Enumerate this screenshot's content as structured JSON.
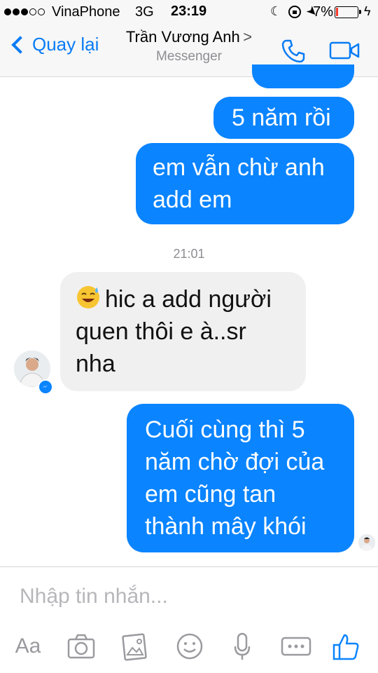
{
  "status_bar": {
    "carrier": "VinaPhone",
    "network": "3G",
    "time": "23:19",
    "battery_percent": "7%"
  },
  "header": {
    "back_label": "Quay lại",
    "contact_name": "Trần Vương Anh",
    "contact_subtitle": "Messenger",
    "accent_color": "#0a7cf5"
  },
  "messages": [
    {
      "side": "out",
      "text": "5 năm rồi"
    },
    {
      "side": "out",
      "lines": [
        "em vẫn chừ anh",
        "add em"
      ]
    },
    {
      "type": "timestamp",
      "text": "21:01"
    },
    {
      "side": "in",
      "emoji": "sweat-smile-emoji",
      "lines": [
        "hic a add người",
        "quen thôi e à..sr",
        "nha"
      ]
    },
    {
      "side": "out",
      "lines": [
        "Cuối cùng thì 5",
        "năm chờ đợi của",
        "em cũng tan",
        "thành mây khói"
      ]
    }
  ],
  "composer": {
    "placeholder": "Nhập tin nhắn...",
    "aa_label": "Aa",
    "tools": [
      "camera-icon",
      "gallery-icon",
      "emoji-icon",
      "microphone-icon",
      "more-icon",
      "like-icon"
    ]
  }
}
